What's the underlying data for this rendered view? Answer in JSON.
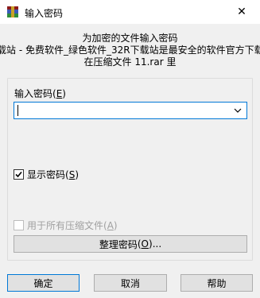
{
  "window": {
    "title": "输入密码",
    "close_symbol": "✕",
    "icon": "winrar-icon"
  },
  "info": {
    "line1": "为加密的文件输入密码",
    "line2": "载站 - 免费软件_绿色软件_32R下载站是最安全的软件官方下载",
    "line3": "在压缩文件 11.rar 里"
  },
  "password": {
    "label": "输入密码",
    "accel": "(E)",
    "value": ""
  },
  "show_password": {
    "label": "显示密码",
    "accel": "(S)",
    "checked": true
  },
  "use_for_all": {
    "label": "用于所有压缩文件",
    "accel": "(A)",
    "checked": false,
    "enabled": false
  },
  "organize_button": {
    "label": "整理密码",
    "accel": "(O)",
    "suffix": "..."
  },
  "buttons": {
    "ok": "确定",
    "cancel": "取消",
    "help": "帮助"
  },
  "colors": {
    "accent": "#0078d7",
    "background": "#f0f0f0",
    "button_face": "#e1e1e1"
  }
}
